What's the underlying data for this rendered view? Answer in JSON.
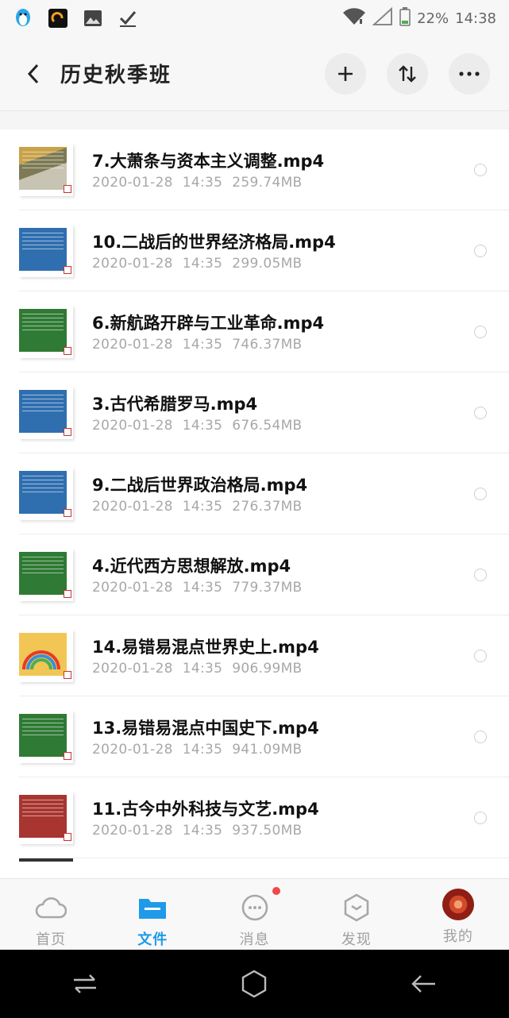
{
  "status_bar": {
    "battery": "22%",
    "time": "14:38",
    "icons": [
      "penguin-icon",
      "app-icon",
      "image-icon",
      "checkmark-icon",
      "wifi-icon",
      "signal-icon",
      "battery-icon"
    ]
  },
  "header": {
    "title": "历史秋季班",
    "icons": [
      "back-arrow-icon",
      "plus-icon",
      "sort-icon",
      "more-icon"
    ]
  },
  "files": [
    {
      "name": "7.大萧条与资本主义调整.mp4",
      "date": "2020-01-28",
      "time": "14:35",
      "size": "259.74MB",
      "thumb": "photo"
    },
    {
      "name": "10.二战后的世界经济格局.mp4",
      "date": "2020-01-28",
      "time": "14:35",
      "size": "299.05MB",
      "thumb": "blue"
    },
    {
      "name": "6.新航路开辟与工业革命.mp4",
      "date": "2020-01-28",
      "time": "14:35",
      "size": "746.37MB",
      "thumb": "green"
    },
    {
      "name": "3.古代希腊罗马.mp4",
      "date": "2020-01-28",
      "time": "14:35",
      "size": "676.54MB",
      "thumb": "blue"
    },
    {
      "name": "9.二战后世界政治格局.mp4",
      "date": "2020-01-28",
      "time": "14:35",
      "size": "276.37MB",
      "thumb": "blue"
    },
    {
      "name": "4.近代西方思想解放.mp4",
      "date": "2020-01-28",
      "time": "14:35",
      "size": "779.37MB",
      "thumb": "green"
    },
    {
      "name": "14.易错易混点世界史上.mp4",
      "date": "2020-01-28",
      "time": "14:35",
      "size": "906.99MB",
      "thumb": "rainbow"
    },
    {
      "name": "13.易错易混点中国史下.mp4",
      "date": "2020-01-28",
      "time": "14:35",
      "size": "941.09MB",
      "thumb": "green"
    },
    {
      "name": "11.古今中外科技与文艺.mp4",
      "date": "2020-01-28",
      "time": "14:35",
      "size": "937.50MB",
      "thumb": "red"
    }
  ],
  "colors": {
    "blue": "#2f6fb0",
    "green": "#2f7a34",
    "red": "#a8352f",
    "accent": "#1e9ae8",
    "badge": "#f0484b"
  },
  "tabbar": [
    {
      "label": "首页",
      "icon": "cloud-icon",
      "active": false
    },
    {
      "label": "文件",
      "icon": "folder-icon",
      "active": true
    },
    {
      "label": "消息",
      "icon": "chat-icon",
      "active": false,
      "badge": true
    },
    {
      "label": "发现",
      "icon": "discover-icon",
      "active": false
    },
    {
      "label": "我的",
      "icon": "avatar-icon",
      "active": false
    }
  ],
  "navbar": {
    "icons": [
      "switch-icon",
      "home-icon",
      "back-icon"
    ]
  }
}
